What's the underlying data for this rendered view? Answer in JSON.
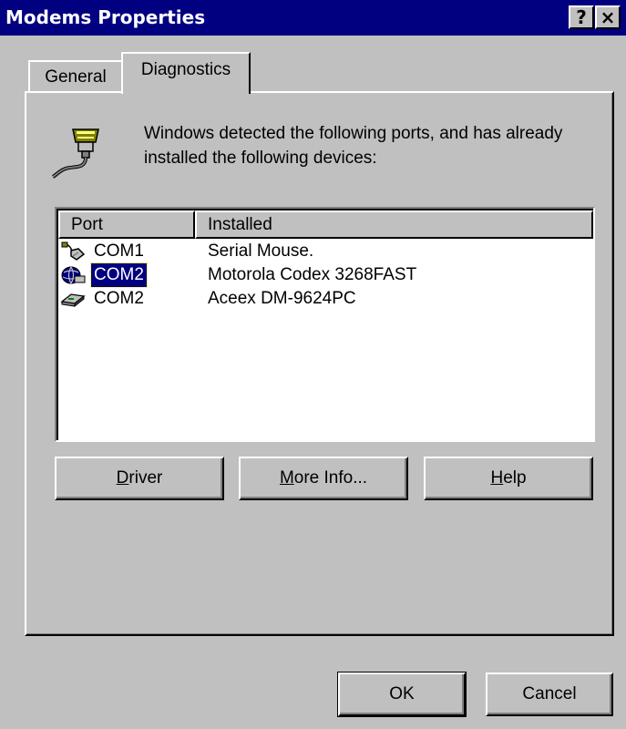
{
  "window": {
    "title": "Modems Properties",
    "help_button": "?",
    "close_button": "×"
  },
  "tabs": [
    {
      "label": "General",
      "selected": false
    },
    {
      "label": "Diagnostics",
      "selected": true
    }
  ],
  "message": "Windows detected the following ports, and has already installed the following devices:",
  "list": {
    "columns": [
      "Port",
      "Installed"
    ],
    "rows": [
      {
        "icon": "serial-mouse-icon",
        "port": "COM1",
        "installed": "Serial Mouse.",
        "selected": false
      },
      {
        "icon": "modem-globe-icon",
        "port": "COM2",
        "installed": "Motorola Codex 3268FAST",
        "selected": true
      },
      {
        "icon": "modem-device-icon",
        "port": "COM2",
        "installed": "Aceex DM-9624PC",
        "selected": false
      }
    ]
  },
  "buttons": {
    "driver_accel": "D",
    "driver_rest": "river",
    "more_info_accel": "M",
    "more_info_rest": "ore Info...",
    "help_accel": "H",
    "help_rest": "elp",
    "ok": "OK",
    "cancel": "Cancel"
  },
  "colors": {
    "titlebar": "#000080",
    "face": "#c0c0c0",
    "selection": "#000080"
  }
}
